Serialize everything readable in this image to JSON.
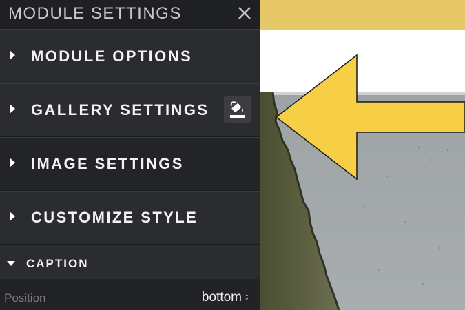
{
  "panel": {
    "title": "MODULE SETTINGS",
    "sections": [
      {
        "label": "MODULE OPTIONS"
      },
      {
        "label": "GALLERY SETTINGS"
      },
      {
        "label": "IMAGE SETTINGS"
      },
      {
        "label": "CUSTOMIZE STYLE"
      }
    ],
    "caption": {
      "label": "CAPTION"
    },
    "position": {
      "label": "Position",
      "value": "bottom"
    }
  },
  "icons": {
    "close": "close-icon",
    "paint": "paint-bucket-icon",
    "select": "chevron-updown-icon"
  },
  "colors": {
    "panel_bg": "#2b2c30",
    "header_bg": "#1f2023",
    "accent_yellow": "#f7cf46",
    "bar_yellow": "#e7c866"
  }
}
